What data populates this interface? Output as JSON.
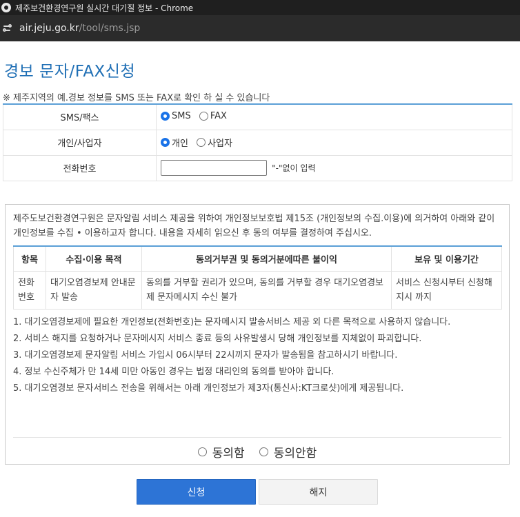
{
  "browser": {
    "window_title": "제주보건환경연구원 실시간 대기질 정보 - Chrome",
    "url_host": "air.jeju.go.kr",
    "url_path": "/tool/sms.jsp"
  },
  "page": {
    "title": "경보 문자/FAX신청",
    "notice": "※ 제주지역의 예.경보 정보를 SMS 또는 FAX로 확인 하 실 수 있습니다"
  },
  "form": {
    "type_label": "SMS/팩스",
    "type_options": [
      "SMS",
      "FAX"
    ],
    "type_selected": "SMS",
    "user_label": "개인/사업자",
    "user_options": [
      "개인",
      "사업자"
    ],
    "user_selected": "개인",
    "phone_label": "전화번호",
    "phone_value": "",
    "phone_hint": "\"-\"없이 입력"
  },
  "consent": {
    "intro": "제주도보건환경연구원은 문자알림 서비스 제공을 위하여 개인정보보호법 제15조 (개인정보의 수집.이용)에 의거하여 아래와 같이 개인정보를 수집 • 이용하고자 합니다. 내용을 자세히 읽으신 후 동의 여부를 결정하여 주십시오.",
    "headers": [
      "항목",
      "수집·이용 목적",
      "동의거부권 및 동의거분에따른 불이익",
      "보유 및 이용기간"
    ],
    "row": [
      "전화번호",
      "대기오염경보제 안내문자 발송",
      "동의를 거부할 권리가 있으며, 동의를 거부할 경우 대기오염경보제 문자메시지 수신 불가",
      "서비스 신청시부터 신청해지시 까지"
    ],
    "rules": [
      "1. 대기오염경보제에 필요한 개인정보(전화번호)는 문자메시지 발송서비스 제공 외 다른 목적으로 사용하지 않습니다.",
      "2. 서비스 해지를 요청하거나 문자메시지 서비스 종료 등의 사유발생시 당해 개인정보를 지체없이 파괴합니다.",
      "3. 대기오염경보제 문자알림 서비스 가입시 06시부터 22시끼지 문자가 발송됨을 참고하시기 바랍니다.",
      "4. 정보 수신주체가 만 14세 미만 아동인 경우는 법정 대리인의 동의를 받아야 합니다.",
      "5. 대기오염경보 문자서비스 전송을 위해서는 아래 개인정보가 제3자(통신사:KT크로샷)에게 제공됩니다."
    ],
    "agree_label": "동의함",
    "disagree_label": "동의안함"
  },
  "buttons": {
    "apply": "신청",
    "cancel": "해지"
  },
  "colors": {
    "title_blue": "#1f6fb5",
    "table_border_blue": "#5a9fd6",
    "apply_button": "#2d74d6"
  }
}
